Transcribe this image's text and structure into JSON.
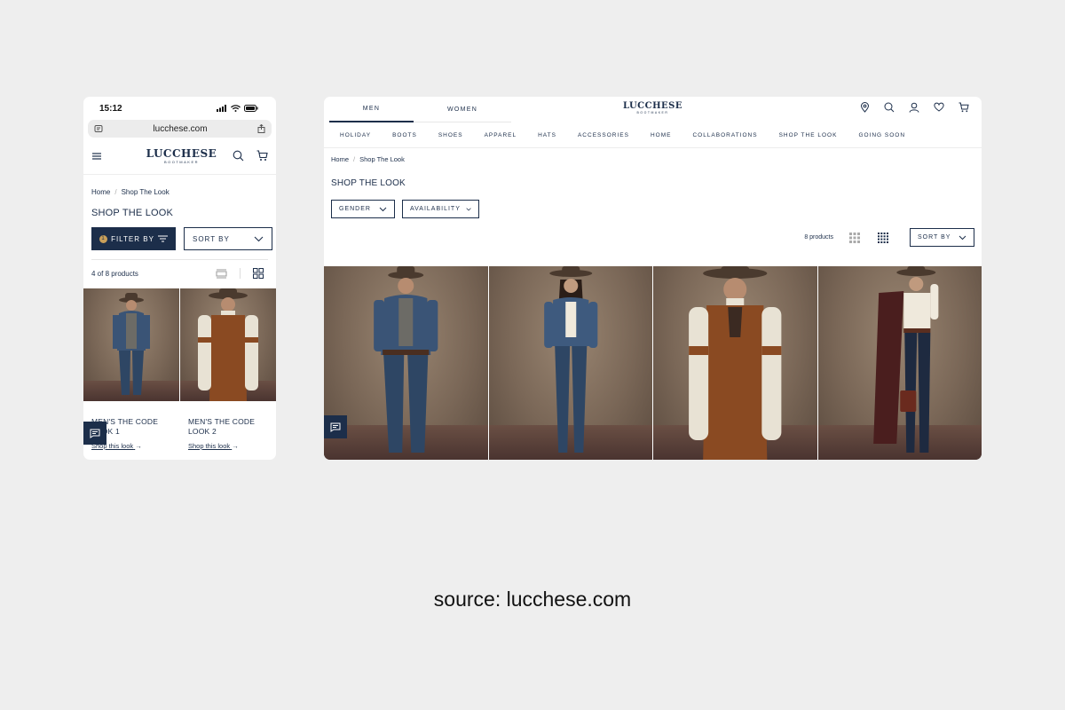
{
  "mobile": {
    "status": {
      "time": "15:12"
    },
    "url": "lucchese.com",
    "logo": {
      "name": "LUCCHESE",
      "sub": "BOOTMAKER"
    },
    "breadcrumb": {
      "home": "Home",
      "sep": "/",
      "current": "Shop The Look"
    },
    "title": "SHOP THE LOOK",
    "filter_by": {
      "label": "FILTER BY",
      "badge": "1"
    },
    "sort_by": "SORT BY",
    "count": "4 of 8 products",
    "products": [
      {
        "title": "MEN'S THE CODE LOOK 1",
        "link": "Shop this look"
      },
      {
        "title": "MEN'S THE CODE LOOK 2",
        "link": "Shop this look"
      }
    ]
  },
  "desktop": {
    "gender_tabs": [
      "MEN",
      "WOMEN"
    ],
    "logo": {
      "name": "LUCCHESE",
      "sub": "BOOTMAKER"
    },
    "nav": [
      "HOLIDAY",
      "BOOTS",
      "SHOES",
      "APPAREL",
      "HATS",
      "ACCESSORIES",
      "HOME",
      "COLLABORATIONS",
      "SHOP THE LOOK",
      "GOING SOON"
    ],
    "breadcrumb": {
      "home": "Home",
      "sep": "/",
      "current": "Shop The Look"
    },
    "title": "SHOP THE LOOK",
    "filters": [
      "GENDER",
      "AVAILABILITY"
    ],
    "count": "8 products",
    "sort_by": "SORT BY"
  },
  "caption": "source: lucchese.com",
  "colors": {
    "navy": "#1c2e4a",
    "background": "#eeeeee"
  },
  "icons": [
    "signal-icon",
    "wifi-icon",
    "battery-icon",
    "menu-icon",
    "search-icon",
    "cart-icon",
    "location-icon",
    "account-icon",
    "heart-icon",
    "chat-icon",
    "chevron-down-icon",
    "filter-icon",
    "grid-icon",
    "list-icon"
  ]
}
